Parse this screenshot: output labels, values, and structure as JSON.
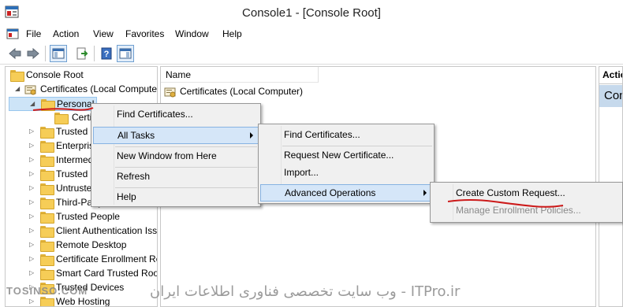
{
  "window": {
    "title": "Console1 - [Console Root]"
  },
  "menu": [
    "File",
    "Action",
    "View",
    "Favorites",
    "Window",
    "Help"
  ],
  "toolbar": {
    "buttons": [
      "back-icon",
      "forward-icon",
      "show-hide-tree-icon",
      "export-list-icon",
      "help-icon",
      "show-hide-action-pane-icon"
    ]
  },
  "tree": {
    "root": "Console Root",
    "certificates": "Certificates (Local Computer)",
    "personal": "Personal",
    "personal_child": "Certificates",
    "items": [
      "Trusted Root Certification Authorities",
      "Enterprise Trust",
      "Intermediate Certification Authorities",
      "Trusted Publishers",
      "Untrusted Certificates",
      "Third-Party Root Certification Authorities",
      "Trusted People",
      "Client Authentication Issuers",
      "Remote Desktop",
      "Certificate Enrollment Requests",
      "Smart Card Trusted Roots",
      "Trusted Devices",
      "Web Hosting"
    ]
  },
  "list": {
    "column_name": "Name",
    "rows": [
      "Certificates (Local Computer)"
    ]
  },
  "actions": {
    "header": "Actions",
    "selected": "Console Root"
  },
  "context_menu": {
    "items": [
      "Find Certificates...",
      "All Tasks",
      "New Window from Here",
      "Refresh",
      "Help"
    ]
  },
  "submenu_all_tasks": {
    "items": [
      "Find Certificates...",
      "Request New Certificate...",
      "Import...",
      "Advanced Operations"
    ]
  },
  "submenu_advanced": {
    "items": [
      "Create Custom Request...",
      "Manage Enrollment Policies..."
    ]
  },
  "watermarks": {
    "left": "TOSINSO.COM",
    "center": "وب سایت تخصصی فناوری اطلاعات ایران - ITPro.ir"
  },
  "colors": {
    "highlight": "#d5e6f8",
    "annotation": "#cc1a1a",
    "folder": "#f6cd57"
  }
}
